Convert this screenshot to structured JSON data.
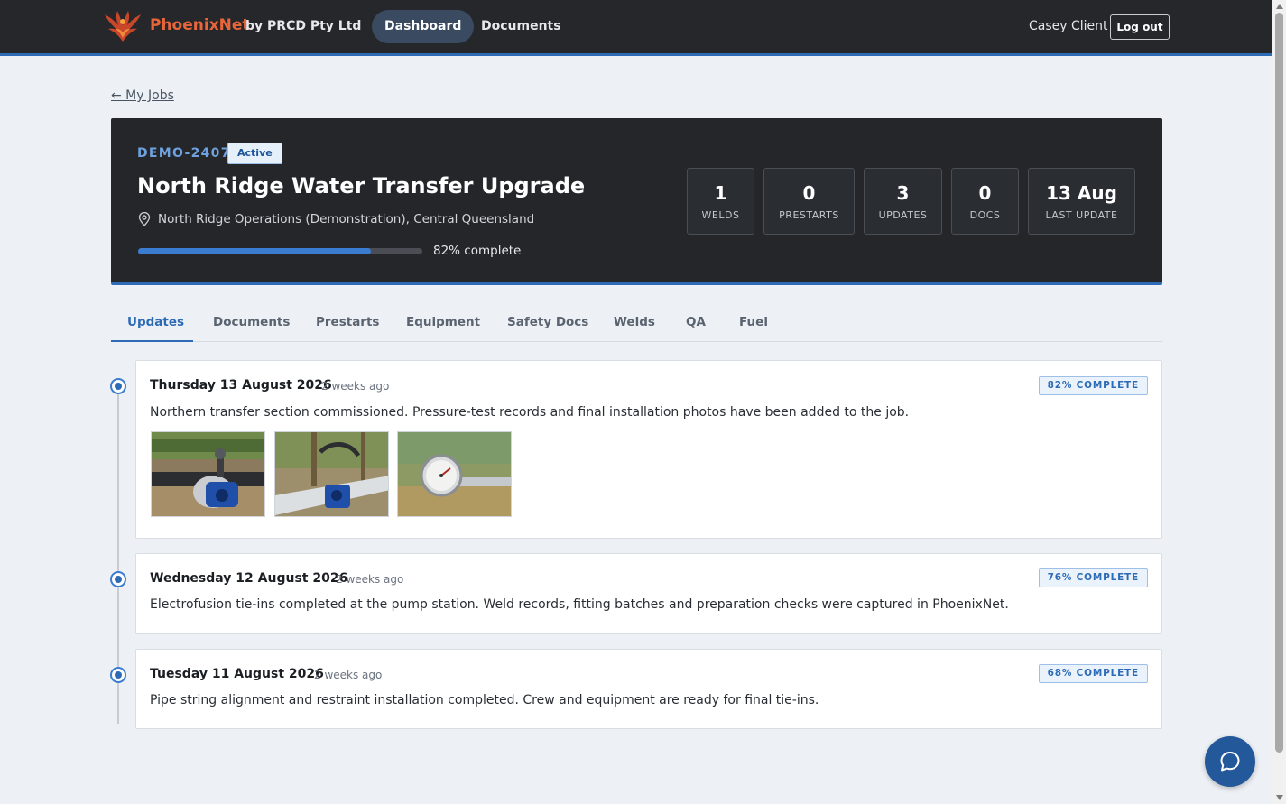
{
  "header": {
    "brand_name": "PhoenixNet",
    "brand_by": "by PRCD Pty Ltd",
    "logo_icon": "phoenix-logo",
    "nav": [
      {
        "label": "Dashboard",
        "active": true
      },
      {
        "label": "Documents",
        "active": false
      }
    ],
    "user_name": "Casey Client",
    "logout_label": "Log out",
    "accent_color": "#2d6bb5"
  },
  "back_link": "← My Jobs",
  "job": {
    "code": "DEMO-2407",
    "status": "Active",
    "title": "North Ridge Water Transfer Upgrade",
    "location_icon": "map-pin-icon",
    "location": "North Ridge Operations (Demonstration), Central Queensland",
    "progress_percent": 82,
    "progress_label": "82% complete",
    "stats": [
      {
        "value": "1",
        "label": "WELDS"
      },
      {
        "value": "0",
        "label": "PRESTARTS"
      },
      {
        "value": "3",
        "label": "UPDATES"
      },
      {
        "value": "0",
        "label": "DOCS"
      },
      {
        "value": "13 Aug",
        "label": "LAST UPDATE"
      }
    ]
  },
  "tabs": [
    "Updates",
    "Documents",
    "Prestarts",
    "Equipment",
    "Safety Docs",
    "Welds",
    "QA",
    "Fuel"
  ],
  "active_tab": "Updates",
  "updates": [
    {
      "date": "Thursday 13 August 2026",
      "ago": "2 weeks ago",
      "badge": "82% COMPLETE",
      "text": "Northern transfer section commissioned. Pressure-test records and final installation photos have been added to the job.",
      "photos": [
        "pipe-valve-photo",
        "pipe-fitting-photo",
        "pressure-gauge-photo"
      ]
    },
    {
      "date": "Wednesday 12 August 2026",
      "ago": "2 weeks ago",
      "badge": "76% COMPLETE",
      "text": "Electrofusion tie-ins completed at the pump station. Weld records, fitting batches and preparation checks were captured in PhoenixNet."
    },
    {
      "date": "Tuesday 11 August 2026",
      "ago": "2 weeks ago",
      "badge": "68% COMPLETE",
      "text": "Pipe string alignment and restraint installation completed. Crew and equipment are ready for final tie-ins."
    }
  ],
  "chat_icon": "chat-bubble-icon"
}
